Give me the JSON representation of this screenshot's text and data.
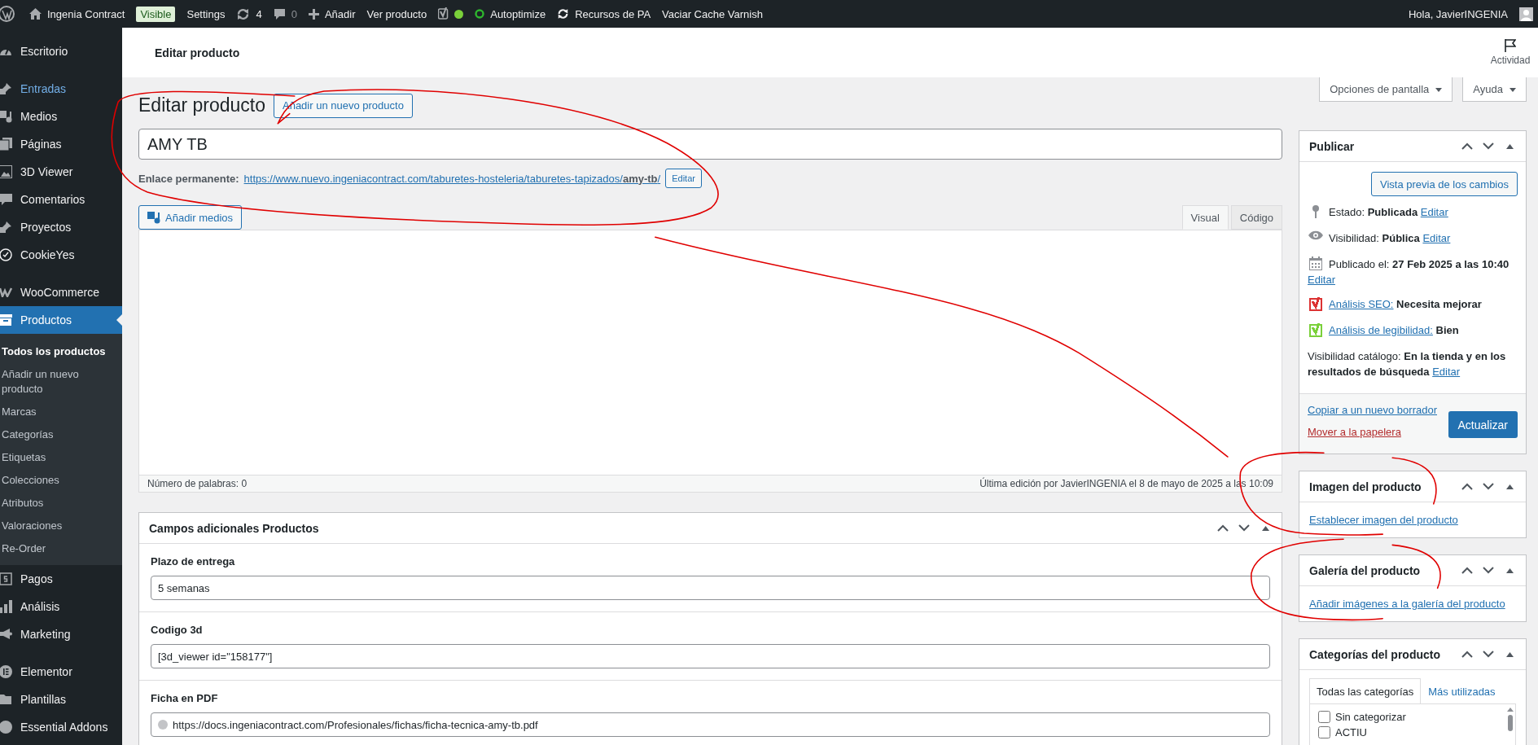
{
  "admin_bar": {
    "items": [
      {
        "kind": "site",
        "label": "Ingenia Contract"
      },
      {
        "kind": "badge",
        "label": "Visible"
      },
      {
        "kind": "link",
        "label": "Settings"
      },
      {
        "kind": "updates",
        "label": "4"
      },
      {
        "kind": "comments",
        "label": "0"
      },
      {
        "kind": "new",
        "label": "Añadir"
      },
      {
        "kind": "link",
        "label": "Ver producto"
      },
      {
        "kind": "seo"
      },
      {
        "kind": "autoptimize",
        "label": "Autoptimize"
      },
      {
        "kind": "refresh",
        "label": "Recursos de PA"
      },
      {
        "kind": "link",
        "label": "Vaciar Cache Varnish"
      }
    ],
    "greeting": "Hola, JavierINGENIA"
  },
  "sidebar": {
    "groups": [
      {
        "items": [
          {
            "label": "Escritorio",
            "selected": false,
            "hovered": false
          }
        ]
      },
      {
        "items": [
          {
            "label": "Entradas",
            "selected": false,
            "hovered": true
          },
          {
            "label": "Medios",
            "selected": false,
            "hovered": false
          },
          {
            "label": "Páginas",
            "selected": false,
            "hovered": false
          },
          {
            "label": "3D Viewer",
            "selected": false,
            "hovered": false
          },
          {
            "label": "Comentarios",
            "selected": false,
            "hovered": false
          },
          {
            "label": "Proyectos",
            "selected": false,
            "hovered": false
          },
          {
            "label": "CookieYes",
            "selected": false,
            "hovered": false
          }
        ]
      },
      {
        "items": [
          {
            "label": "WooCommerce",
            "selected": false,
            "hovered": false
          },
          {
            "label": "Productos",
            "selected": true,
            "hovered": false,
            "children": [
              {
                "label": "Todos los productos",
                "selected": true
              },
              {
                "label": "Añadir un nuevo producto",
                "selected": false
              },
              {
                "label": "Marcas",
                "selected": false
              },
              {
                "label": "Categorías",
                "selected": false
              },
              {
                "label": "Etiquetas",
                "selected": false
              },
              {
                "label": "Colecciones",
                "selected": false
              },
              {
                "label": "Atributos",
                "selected": false
              },
              {
                "label": "Valoraciones",
                "selected": false
              },
              {
                "label": "Re-Order",
                "selected": false
              }
            ]
          },
          {
            "label": "Pagos",
            "selected": false,
            "hovered": false
          },
          {
            "label": "Análisis",
            "selected": false,
            "hovered": false
          },
          {
            "label": "Marketing",
            "selected": false,
            "hovered": false
          }
        ]
      },
      {
        "items": [
          {
            "label": "Elementor",
            "selected": false,
            "hovered": false
          },
          {
            "label": "Plantillas",
            "selected": false,
            "hovered": false
          },
          {
            "label": "Essential Addons",
            "selected": false,
            "hovered": false
          }
        ]
      }
    ]
  },
  "header": {
    "title": "Editar producto",
    "activity": "Actividad"
  },
  "screen_options": "Opciones de pantalla",
  "help": "Ayuda",
  "editor": {
    "heading": "Editar producto",
    "add_new": "Añadir un nuevo producto",
    "product_title": "AMY TB",
    "permalink_label": "Enlace permanente:",
    "permalink": "https://www.nuevo.ingeniacontract.com/taburetes-hosteleria/taburetes-tapizados/**amy-tb**/",
    "permalink_edit": "Editar",
    "add_media": "Añadir medios",
    "tabs": [
      {
        "label": "Visual",
        "selected": true
      },
      {
        "label": "Código",
        "selected": false
      }
    ],
    "word_count": "Número de palabras: 0",
    "last_edit": "Última edición por JavierINGENIA el 8 de mayo de 2025 a las 10:09"
  },
  "custom_fields": {
    "title": "Campos adicionales Productos",
    "fields": [
      {
        "kind": "text",
        "label": "Plazo de entrega",
        "value": "5 semanas"
      },
      {
        "kind": "text",
        "label": "Codigo 3d",
        "value": "[3d_viewer id=\"158177\"]"
      },
      {
        "kind": "url",
        "label": "Ficha en PDF",
        "value": "https://docs.ingeniacontract.com/Profesionales/fichas/ficha-tecnica-amy-tb.pdf"
      }
    ]
  },
  "publish": {
    "title": "Publicar",
    "preview": "Vista previa de los cambios",
    "rows": [
      {
        "kind": "status",
        "text": "Estado: **Publicada**",
        "link": "Editar"
      },
      {
        "kind": "visibility",
        "text": "Visibilidad: **Pública**",
        "link": "Editar"
      },
      {
        "kind": "date",
        "text": "Publicado el: **27 Feb 2025 a las 10:40**",
        "link": "Editar"
      },
      {
        "kind": "score",
        "link": "Análisis SEO:",
        "value": "Necesita mejorar",
        "color": "#dc3232"
      },
      {
        "kind": "score",
        "link": "Análisis de legibilidad:",
        "value": "Bien",
        "color": "#7ad03a"
      },
      {
        "kind": "catalog",
        "text": "Visibilidad catálogo: **En la tienda y en los resultados de búsqueda**",
        "link": "Editar"
      }
    ],
    "copy": "Copiar a un nuevo borrador",
    "trash": "Mover a la papelera",
    "update": "Actualizar"
  },
  "product_image": {
    "title": "Imagen del producto",
    "link": "Establecer imagen del producto"
  },
  "gallery": {
    "title": "Galería del producto",
    "link": "Añadir imágenes a la galería del producto"
  },
  "categories": {
    "title": "Categorías del producto",
    "tabs": [
      {
        "label": "Todas las categorías",
        "selected": true
      },
      {
        "label": "Más utilizadas",
        "selected": false
      }
    ],
    "items": [
      {
        "label": "Sin categorizar",
        "checked": false
      },
      {
        "label": "ACTIU",
        "checked": false
      }
    ]
  }
}
